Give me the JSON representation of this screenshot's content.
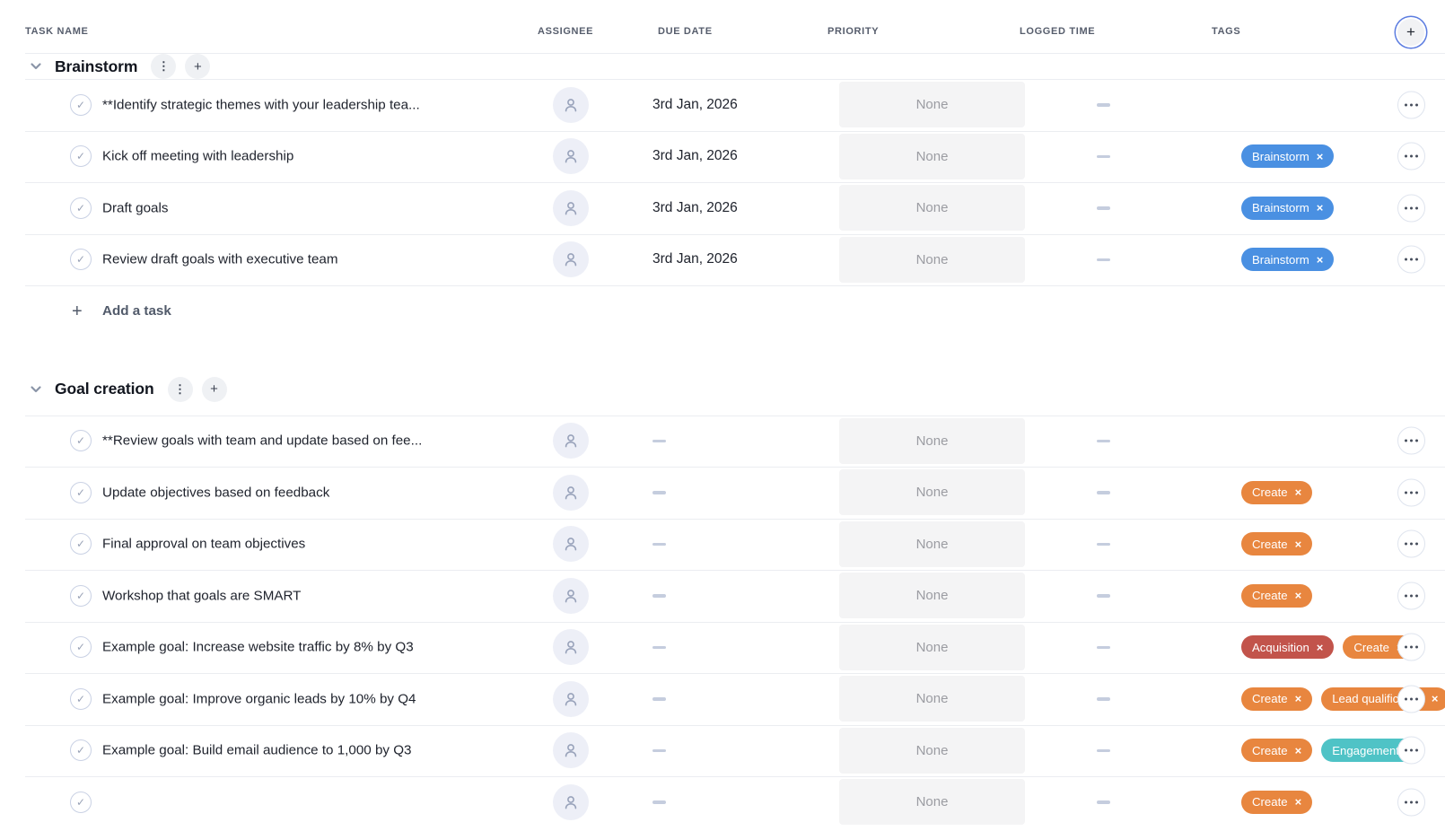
{
  "theme": {
    "tag_blue": "#4a90e2",
    "tag_orange": "#e8863f",
    "tag_red": "#c2544b",
    "tag_teal": "#4fc3c6",
    "add_button_ring": "#5b7ce0",
    "priority_box_bg": "#f4f4f5"
  },
  "icons": {
    "add": "+",
    "kebab": "⋮",
    "check": "✓",
    "tag_remove": "×",
    "chevron_down": "v",
    "person": "user-silhouette",
    "ellipsis": "three-dots"
  },
  "columns": [
    "TASK NAME",
    "ASSIGNEE",
    "DUE DATE",
    "PRIORITY",
    "LOGGED TIME",
    "TAGS"
  ],
  "sections": [
    {
      "title": "Brainstorm",
      "add_task_label": "Add a task",
      "tasks": [
        {
          "name": "**Identify strategic themes with your leadership tea...",
          "due": "3rd Jan, 2026",
          "priority": "None",
          "tags": []
        },
        {
          "name": "Kick off meeting with leadership",
          "due": "3rd Jan, 2026",
          "priority": "None",
          "tags": [
            {
              "label": "Brainstorm",
              "color": "blue"
            }
          ]
        },
        {
          "name": "Draft goals",
          "due": "3rd Jan, 2026",
          "priority": "None",
          "tags": [
            {
              "label": "Brainstorm",
              "color": "blue"
            }
          ]
        },
        {
          "name": "Review draft goals with executive team",
          "due": "3rd Jan, 2026",
          "priority": "None",
          "tags": [
            {
              "label": "Brainstorm",
              "color": "blue"
            }
          ]
        }
      ]
    },
    {
      "title": "Goal creation",
      "tasks": [
        {
          "name": "**Review goals with team and update based on fee...",
          "priority": "None",
          "tags": []
        },
        {
          "name": "Update objectives based on feedback",
          "priority": "None",
          "tags": [
            {
              "label": "Create",
              "color": "orange"
            }
          ]
        },
        {
          "name": "Final approval on team objectives",
          "priority": "None",
          "tags": [
            {
              "label": "Create",
              "color": "orange"
            }
          ]
        },
        {
          "name": "Workshop that goals are SMART",
          "priority": "None",
          "tags": [
            {
              "label": "Create",
              "color": "orange"
            }
          ]
        },
        {
          "name": "Example goal: Increase website traffic by 8% by Q3",
          "priority": "None",
          "tags": [
            {
              "label": "Acquisition",
              "color": "red"
            },
            {
              "label": "Create",
              "color": "orange"
            }
          ]
        },
        {
          "name": "Example goal: Improve organic leads by 10% by Q4",
          "priority": "None",
          "tags": [
            {
              "label": "Create",
              "color": "orange"
            },
            {
              "label": "Lead qualification",
              "color": "orange"
            }
          ]
        },
        {
          "name": "Example goal: Build email audience to 1,000 by Q3",
          "priority": "None",
          "tags": [
            {
              "label": "Create",
              "color": "orange"
            },
            {
              "label": "Engagement",
              "color": "teal"
            }
          ]
        },
        {
          "name": "",
          "priority": "None",
          "tags": [
            {
              "label": "Create",
              "color": "orange"
            }
          ]
        }
      ]
    }
  ]
}
